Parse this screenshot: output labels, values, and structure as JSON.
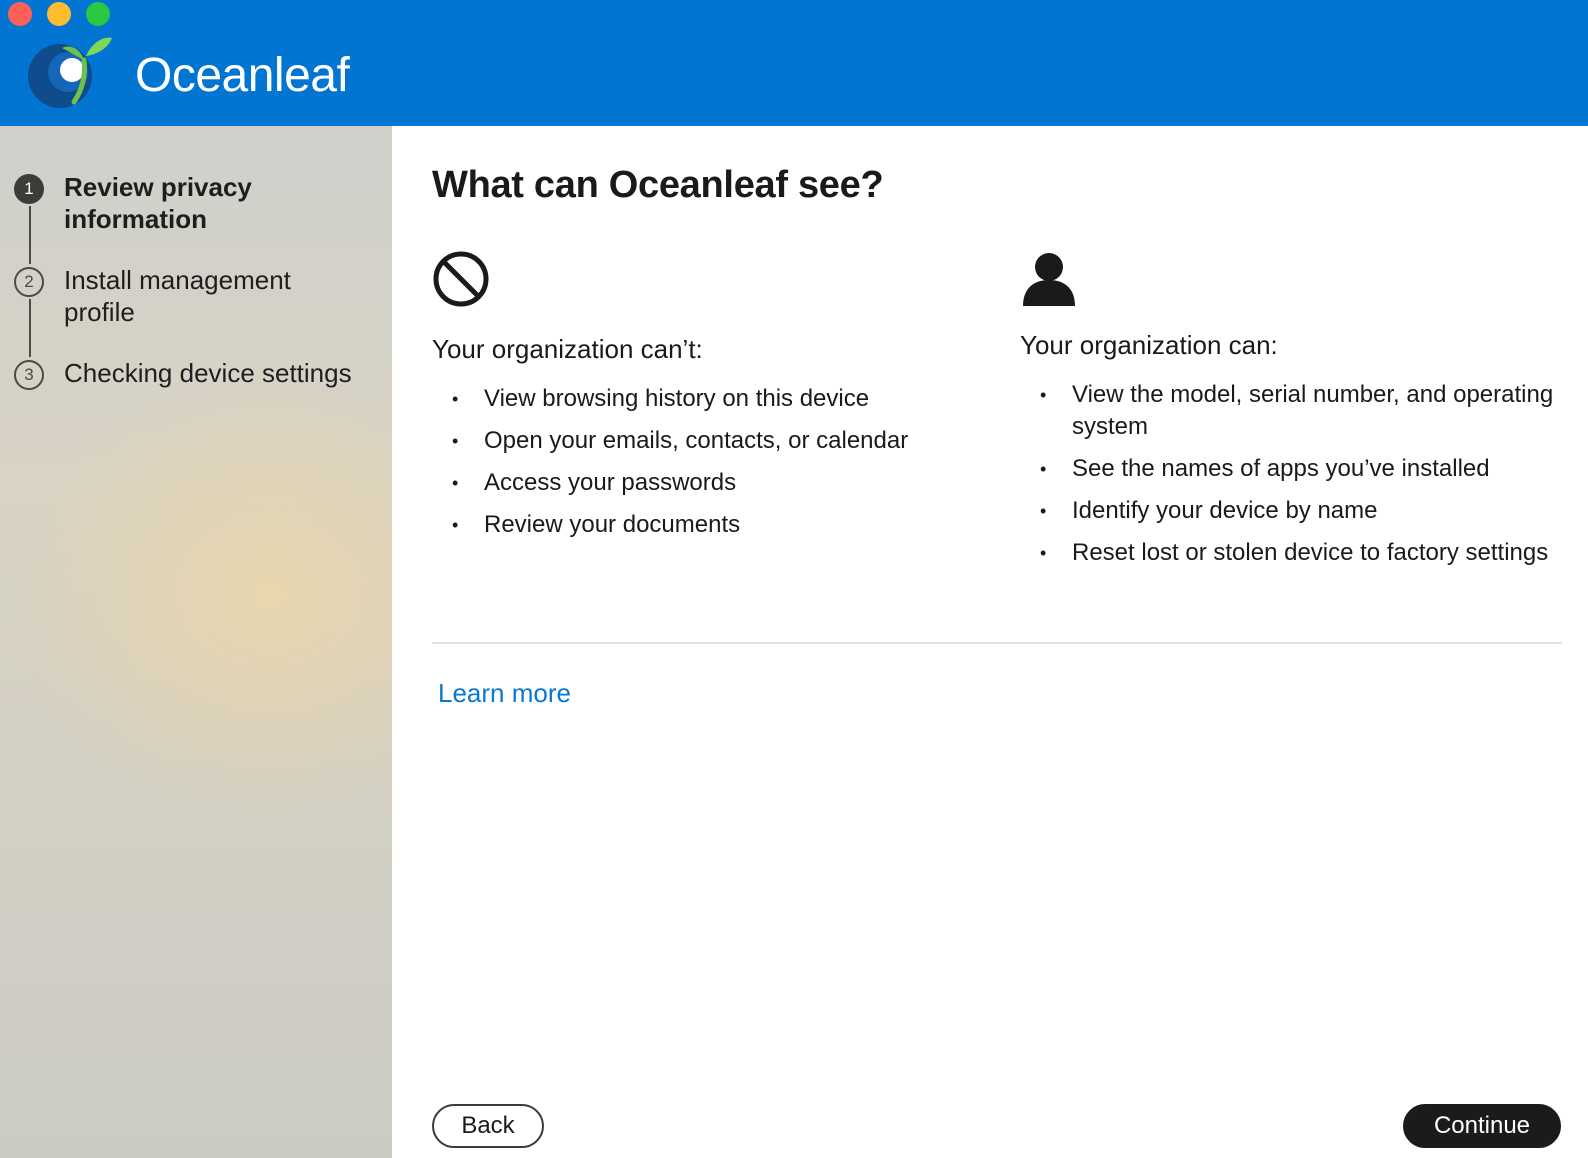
{
  "window": {
    "controls": [
      "close",
      "minimize",
      "zoom"
    ]
  },
  "header": {
    "app_name": "Oceanleaf",
    "logo_icon": "oceanleaf-logo-icon",
    "background": "#0275d3"
  },
  "sidebar": {
    "steps": [
      {
        "number": "1",
        "label": "Review privacy information",
        "state": "active"
      },
      {
        "number": "2",
        "label": "Install management profile",
        "state": "pending"
      },
      {
        "number": "3",
        "label": "Checking device settings",
        "state": "pending"
      }
    ]
  },
  "main": {
    "title": "What can Oceanleaf see?",
    "cant": {
      "icon": "prohibited-icon",
      "heading": "Your organization can’t:",
      "items": [
        "View browsing history on this device",
        "Open your emails, contacts, or calendar",
        "Access your passwords",
        "Review your documents"
      ]
    },
    "can": {
      "icon": "person-icon",
      "heading": "Your organization can:",
      "items": [
        "View the model, serial number, and operating system",
        "See the names of apps you’ve installed",
        "Identify your device by name",
        "Reset lost or stolen device to factory settings"
      ]
    },
    "learn_more": "Learn more",
    "link_color": "#0b78d0"
  },
  "footer": {
    "back_label": "Back",
    "continue_label": "Continue"
  }
}
